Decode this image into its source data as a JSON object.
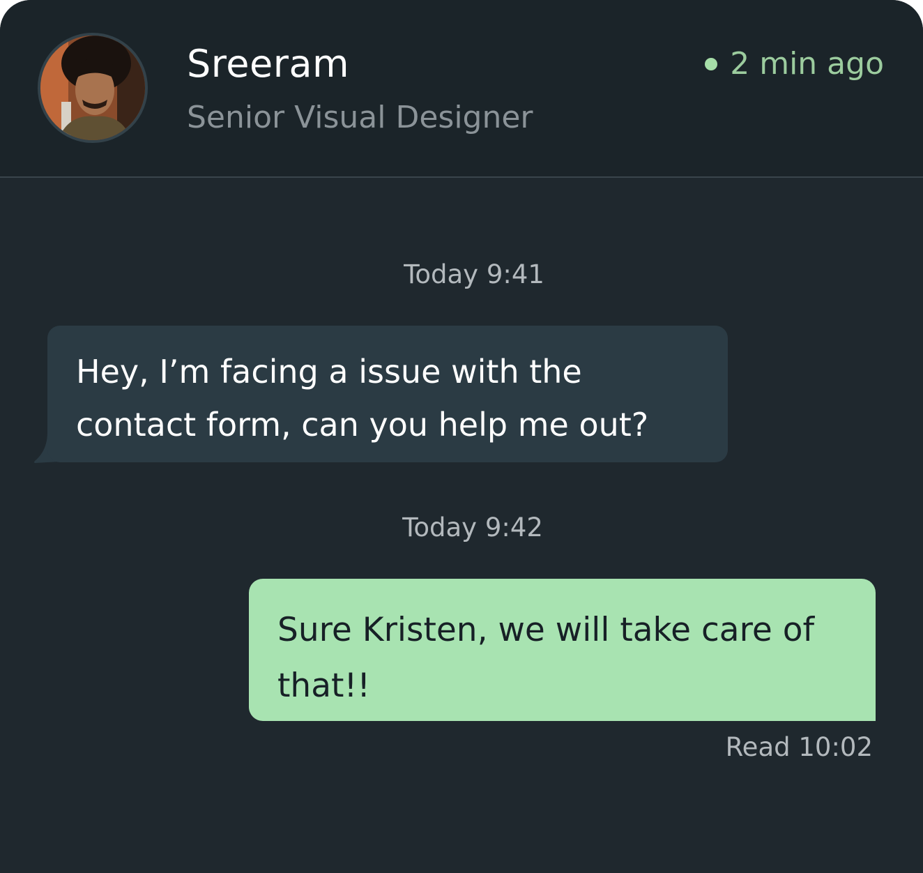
{
  "header": {
    "name": "Sreeram",
    "role": "Senior Visual Designer",
    "status_text": "2 min ago",
    "avatar_icon": "user-photo"
  },
  "messages": [
    {
      "timestamp": "Today 9:41",
      "direction": "incoming",
      "lines": [
        "Hey, I’m facing a issue with the",
        "contact form, can you help me out?"
      ]
    },
    {
      "timestamp": "Today 9:42",
      "direction": "outgoing",
      "lines": [
        "Sure Kristen, we will take care of",
        "that!!"
      ],
      "receipt": "Read 10:02"
    }
  ],
  "colors": {
    "background": "#1f282e",
    "header": "#1b2429",
    "incoming_bubble": "#2b3b44",
    "outgoing_bubble": "#a8e3b1",
    "online": "#a6dea8"
  }
}
